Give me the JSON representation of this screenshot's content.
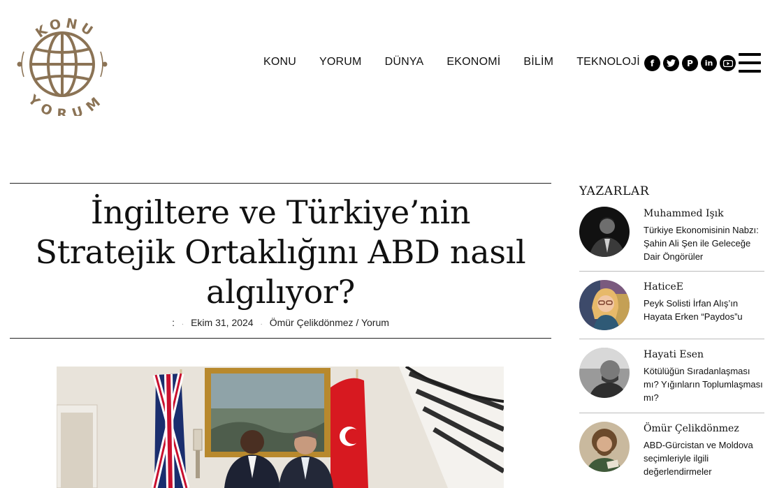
{
  "logo": {
    "top_text": "KONU",
    "bottom_text": "YORUM"
  },
  "nav": [
    "KONU",
    "YORUM",
    "DÜNYA",
    "EKONOMİ",
    "BİLİM",
    "TEKNOLOJİ"
  ],
  "social": [
    "facebook-icon",
    "twitter-icon",
    "pinterest-icon",
    "linkedin-icon",
    "youtube-icon"
  ],
  "article": {
    "title": "İngiltere ve Türkiye’nin Stratejik Ortaklığını ABD nasıl algılıyor?",
    "meta_colon": ":",
    "date": "Ekim 31, 2024",
    "author": "Ömür Çelikdönmez",
    "category": "Yorum",
    "byline": "Ömür Çelikdönmez / Yorum"
  },
  "sidebar": {
    "title": "YAZARLAR",
    "authors": [
      {
        "name": "Muhammed Işık",
        "post": "Türkiye Ekonomisinin Nabzı: Şahin Ali Şen ile Geleceğe Dair Öngörüler"
      },
      {
        "name": "HaticeE",
        "post": "Peyk Solisti İrfan Alış’ın Hayata Erken “Paydos”u"
      },
      {
        "name": "Hayati Esen",
        "post": "Kötülüğün Sıradanlaşması mı? Yığınların Toplumlaşması mı?"
      },
      {
        "name": "Ömür Çelikdönmez",
        "post": "ABD-Gürcistan ve Moldova seçimleriyle ilgili değerlendirmeler"
      }
    ]
  },
  "colors": {
    "logo": "#8b7355",
    "text": "#111111",
    "divider": "#bbbbbb"
  }
}
